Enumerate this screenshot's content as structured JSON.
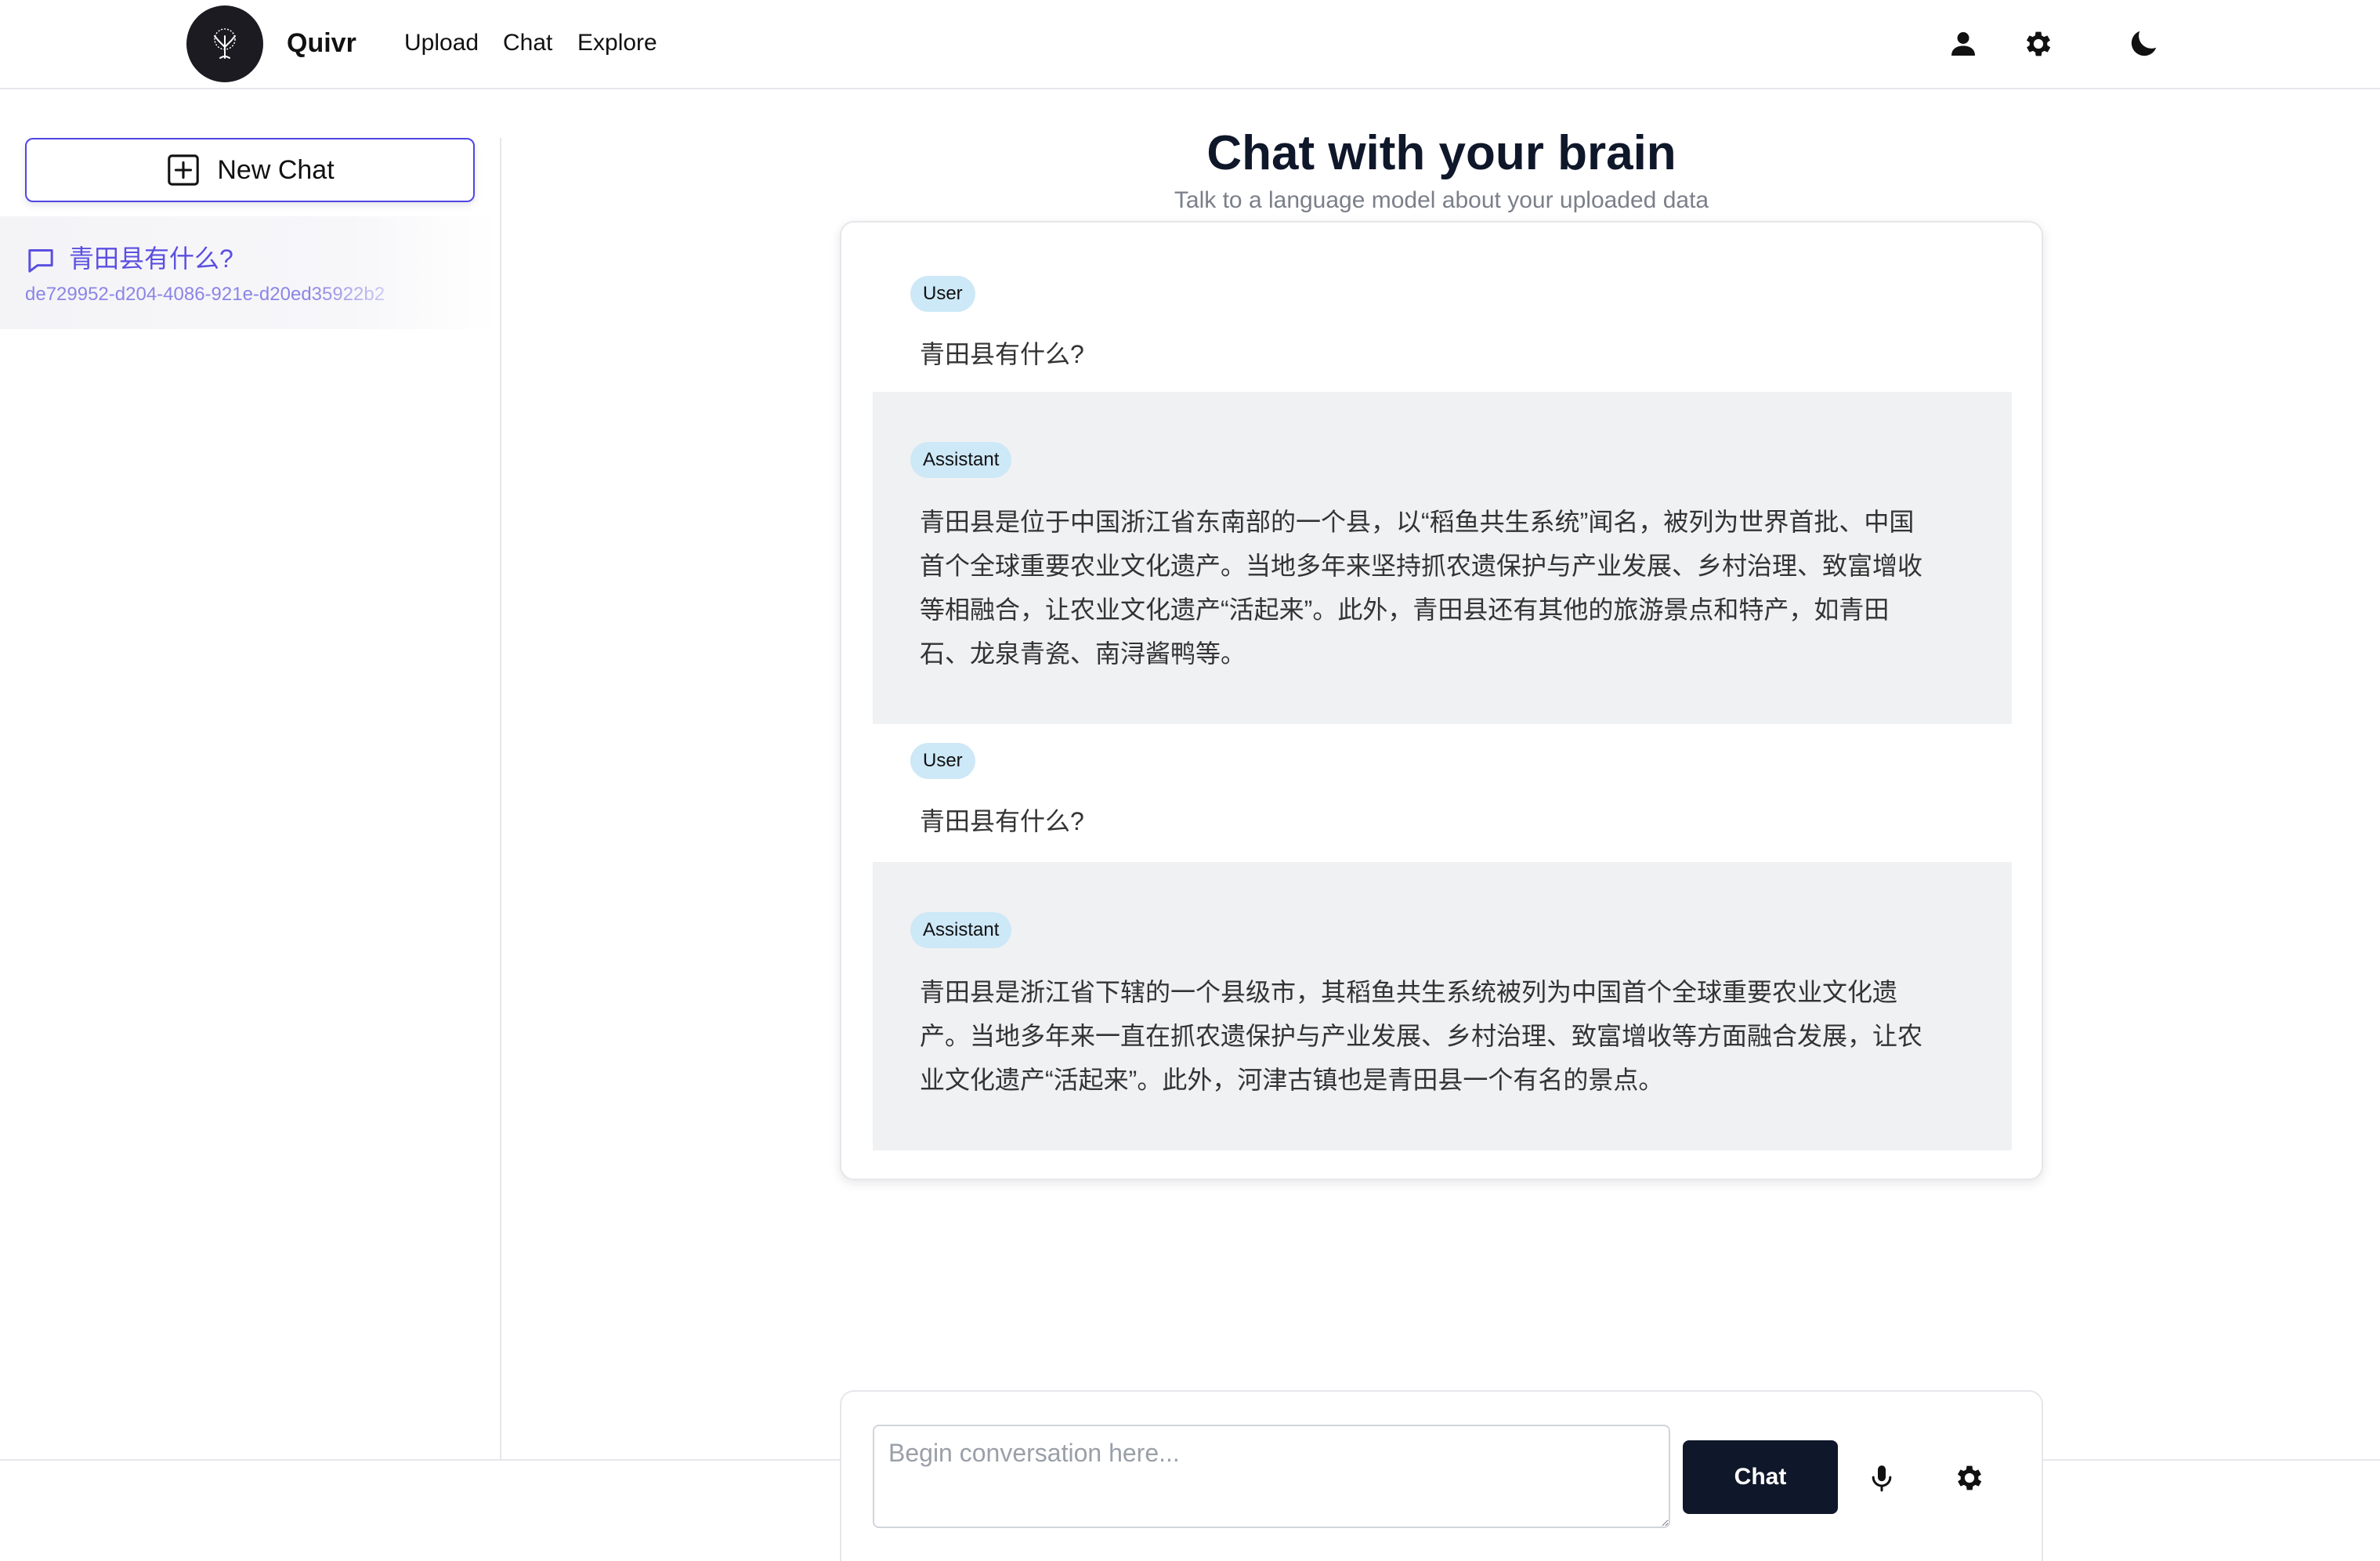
{
  "header": {
    "brand": "Quivr",
    "nav": [
      "Upload",
      "Chat",
      "Explore"
    ],
    "icons": [
      "user-icon",
      "gear-icon",
      "moon-icon"
    ]
  },
  "sidebar": {
    "new_chat_label": "New Chat",
    "chats": [
      {
        "title": "青田县有什么?",
        "id": "de729952-d204-4086-921e-d20ed35922b2"
      }
    ]
  },
  "main": {
    "title": "Chat with your brain",
    "subtitle": "Talk to a language model about your uploaded data"
  },
  "messages": [
    {
      "role": "User",
      "text": "青田县有什么?"
    },
    {
      "role": "Assistant",
      "text": "青田县是位于中国浙江省东南部的一个县，以“稻鱼共生系统”闻名，被列为世界首批、中国首个全球重要农业文化遗产。当地多年来坚持抓农遗保护与产业发展、乡村治理、致富增收等相融合，让农业文化遗产“活起来”。此外，青田县还有其他的旅游景点和特产，如青田石、龙泉青瓷、南浔酱鸭等。"
    },
    {
      "role": "User",
      "text": "青田县有什么?"
    },
    {
      "role": "Assistant",
      "text": "青田县是浙江省下辖的一个县级市，其稻鱼共生系统被列为中国首个全球重要农业文化遗产。当地多年来一直在抓农遗保护与产业发展、乡村治理、致富增收等方面融合发展，让农业文化遗产“活起来”。此外，河津古镇也是青田县一个有名的景点。"
    }
  ],
  "composer": {
    "placeholder": "Begin conversation here...",
    "send_label": "Chat",
    "icons": [
      "microphone-icon",
      "gear-icon"
    ]
  },
  "colors": {
    "accent": "#4f46e5",
    "badge": "#cde8f7",
    "assistant_bg": "#f0f1f3",
    "send_button": "#0f172a"
  }
}
